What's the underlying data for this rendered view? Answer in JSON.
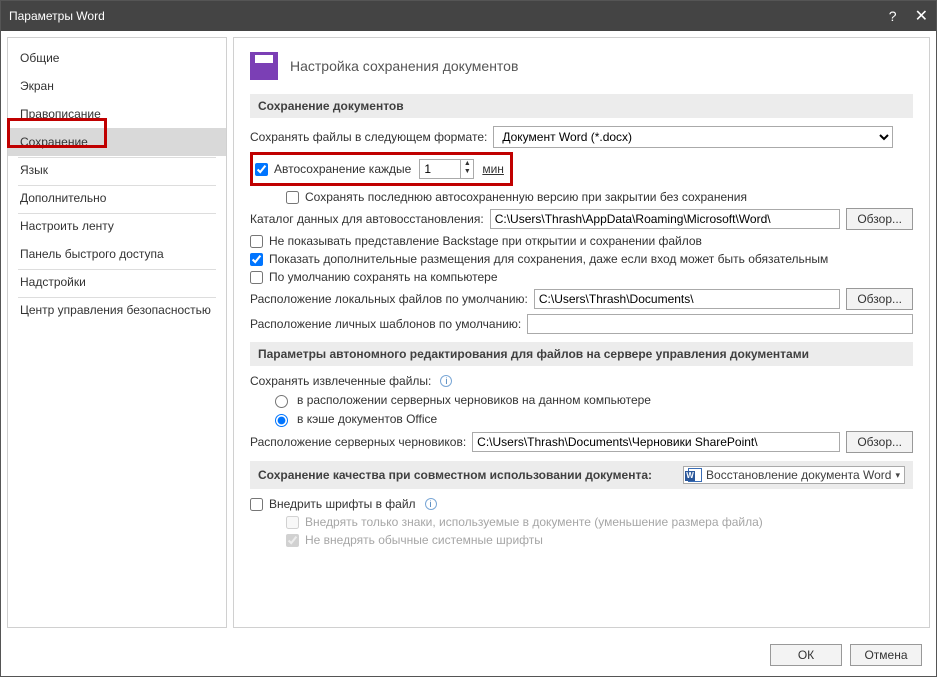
{
  "titlebar": {
    "title": "Параметры Word"
  },
  "sidebar": {
    "items": [
      {
        "label": "Общие"
      },
      {
        "label": "Экран"
      },
      {
        "label": "Правописание"
      },
      {
        "label": "Сохранение"
      },
      {
        "label": "Язык"
      },
      {
        "label": "Дополнительно"
      },
      {
        "label": "Настроить ленту"
      },
      {
        "label": "Панель быстрого доступа"
      },
      {
        "label": "Надстройки"
      },
      {
        "label": "Центр управления безопасностью"
      }
    ]
  },
  "header": {
    "title": "Настройка сохранения документов"
  },
  "sections": {
    "save_docs": "Сохранение документов",
    "offline": "Параметры автономного редактирования для файлов на сервере управления документами",
    "quality": "Сохранение качества при совместном использовании документа:"
  },
  "save": {
    "format_label": "Сохранять файлы в следующем формате:",
    "format_value": "Документ Word (*.docx)",
    "autosave_label": "Автосохранение каждые",
    "autosave_value": "1",
    "autosave_unit": "мин",
    "keep_last_label": "Сохранять последнюю автосохраненную версию при закрытии без сохранения",
    "autorecover_dir_label": "Каталог данных для автовосстановления:",
    "autorecover_dir_value": "C:\\Users\\Thrash\\AppData\\Roaming\\Microsoft\\Word\\",
    "browse": "Обзор...",
    "no_backstage_label": "Не показывать представление Backstage при открытии и сохранении файлов",
    "show_additional_label": "Показать дополнительные размещения для сохранения, даже если вход может быть обязательным",
    "default_computer_label": "По умолчанию сохранять на компьютере",
    "local_default_label": "Расположение локальных файлов по умолчанию:",
    "local_default_value": "C:\\Users\\Thrash\\Documents\\",
    "personal_templates_label": "Расположение личных шаблонов по умолчанию:",
    "personal_templates_value": ""
  },
  "offline": {
    "extracted_label": "Сохранять извлеченные файлы:",
    "radio_local": "в расположении серверных черновиков на данном компьютере",
    "radio_cache": "в кэше документов Office",
    "drafts_label": "Расположение серверных черновиков:",
    "drafts_value": "C:\\Users\\Thrash\\Documents\\Черновики SharePoint\\"
  },
  "quality": {
    "doc_value": "Восстановление документа Word",
    "embed_fonts": "Внедрить шрифты в файл",
    "embed_used_only": "Внедрять только знаки, используемые в документе (уменьшение размера файла)",
    "no_system_fonts": "Не внедрять обычные системные шрифты"
  },
  "footer": {
    "ok": "ОК",
    "cancel": "Отмена"
  }
}
